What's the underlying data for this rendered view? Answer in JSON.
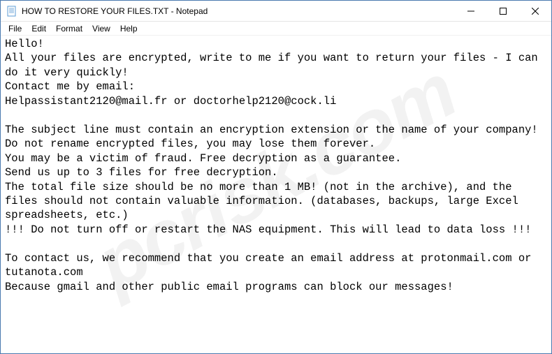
{
  "window": {
    "title": "HOW TO RESTORE YOUR FILES.TXT - Notepad"
  },
  "menubar": {
    "items": [
      "File",
      "Edit",
      "Format",
      "View",
      "Help"
    ]
  },
  "content": {
    "text": "Hello!\nAll your files are encrypted, write to me if you want to return your files - I can do it very quickly!\nContact me by email:\nHelpassistant2120@mail.fr or doctorhelp2120@cock.li\n\nThe subject line must contain an encryption extension or the name of your company!\nDo not rename encrypted files, you may lose them forever.\nYou may be a victim of fraud. Free decryption as a guarantee.\nSend us up to 3 files for free decryption.\nThe total file size should be no more than 1 MB! (not in the archive), and the files should not contain valuable information. (databases, backups, large Excel spreadsheets, etc.)\n!!! Do not turn off or restart the NAS equipment. This will lead to data loss !!!\n\nTo contact us, we recommend that you create an email address at protonmail.com or tutanota.com\nBecause gmail and other public email programs can block our messages!"
  },
  "watermark": {
    "text": "pcrisk.com"
  }
}
